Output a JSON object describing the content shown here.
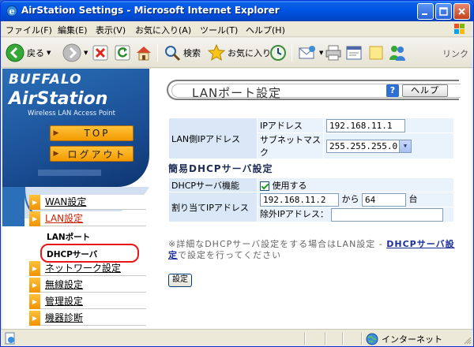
{
  "window": {
    "title": "AirStation Settings - Microsoft Internet Explorer"
  },
  "menubar": {
    "items": [
      "ファイル(F)",
      "編集(E)",
      "表示(V)",
      "お気に入り(A)",
      "ツール(T)",
      "ヘルプ(H)"
    ]
  },
  "toolbar": {
    "back_label": "戻る",
    "search_label": "検索",
    "favorites_label": "お気に入り",
    "links_label": "リンク"
  },
  "sidebar": {
    "logo_brand": "BUFFALO",
    "logo_product": "AirStation",
    "logo_tagline": "Wireless LAN Access Point",
    "top_button": "TOP",
    "logout_button": "ログアウト",
    "items": [
      {
        "label": "WAN設定",
        "active": false
      },
      {
        "label": "LAN設定",
        "active": true
      },
      {
        "label": "ネットワーク設定",
        "active": false
      },
      {
        "label": "無線設定",
        "active": false
      },
      {
        "label": "管理設定",
        "active": false
      },
      {
        "label": "機器診断",
        "active": false
      }
    ],
    "sub_items": [
      "LANポート",
      "DHCPサーバ"
    ]
  },
  "main": {
    "title": "LANポート設定",
    "help_label": "ヘルプ",
    "lan": {
      "row_label": "LAN側IPアドレス",
      "ip_label": "IPアドレス",
      "ip_value": "192.168.11.1",
      "mask_label": "サブネットマスク",
      "mask_value": "255.255.255.0"
    },
    "dhcp": {
      "section_title": "簡易DHCPサーバ設定",
      "feature_label": "DHCPサーバ機能",
      "use_label": "使用する",
      "use_checked": true,
      "assign_label": "割り当てIPアドレス",
      "start_ip": "192.168.11.2",
      "from_label": "から",
      "count": "64",
      "unit_label": "台",
      "exclude_label": "除外IPアドレス：",
      "exclude_value": ""
    },
    "note_prefix": "※詳細なDHCPサーバ設定をする場合はLAN設定 - ",
    "note_link": "DHCPサーバ設定",
    "note_suffix": "で設定を行ってください",
    "apply_button": "設定"
  },
  "statusbar": {
    "zone_label": "インターネット"
  }
}
